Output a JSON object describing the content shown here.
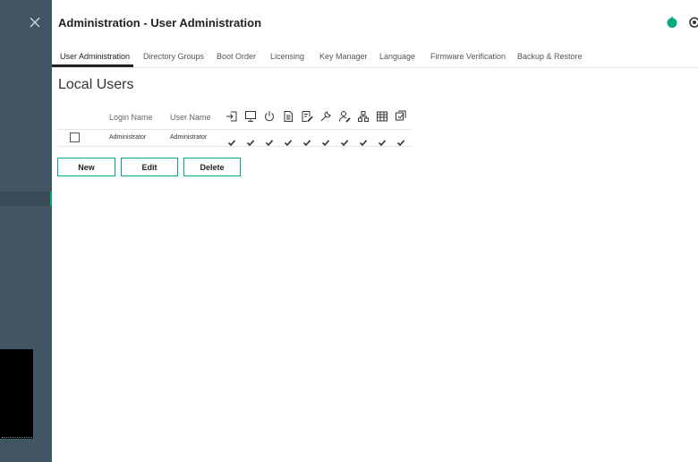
{
  "header": {
    "title": "Administration - User Administration",
    "status_color": "#01a982"
  },
  "tabs": [
    {
      "label": "User Administration",
      "active": true
    },
    {
      "label": "Directory Groups"
    },
    {
      "label": "Boot Order"
    },
    {
      "label": "Licensing"
    },
    {
      "label": "Key Manager"
    },
    {
      "label": "Language"
    },
    {
      "label": "Firmware Verification"
    },
    {
      "label": "Backup & Restore"
    }
  ],
  "local_users": {
    "title": "Local Users",
    "columns": {
      "login_name": "Login Name",
      "user_name": "User Name",
      "permission_icons": [
        "login-icon",
        "remote-console-icon",
        "power-icon",
        "virtual-media-icon",
        "config-settings-icon",
        "admin-accounts-icon",
        "user-config-icon",
        "host-nic-config-icon",
        "host-storage-config-icon",
        "recovery-set-icon"
      ]
    },
    "rows": [
      {
        "login_name": "Administrator",
        "user_name": "Administrator",
        "permissions": [
          true,
          true,
          true,
          true,
          true,
          true,
          true,
          true,
          true,
          true
        ]
      }
    ]
  },
  "actions": {
    "new_label": "New",
    "edit_label": "Edit",
    "delete_label": "Delete"
  },
  "colors": {
    "sidebar": "#425563",
    "accent": "#01a982"
  }
}
